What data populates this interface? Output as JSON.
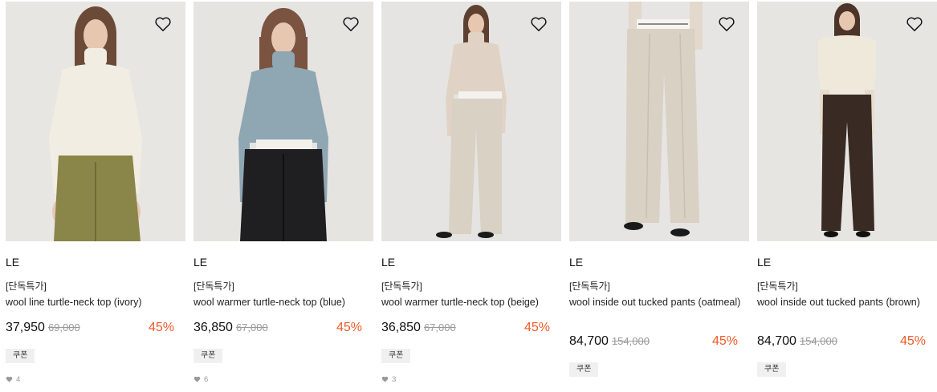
{
  "products": [
    {
      "brand": "LE",
      "promo": "[단독특가]",
      "name": "wool line turtle-neck top (ivory)",
      "price": "37,950",
      "original_price": "69,000",
      "discount": "45%",
      "coupon": "쿠폰",
      "likes": "4",
      "top_color": "#f1ede2",
      "bottom_color": "#8a8548",
      "bg_color": "#e8e6e3"
    },
    {
      "brand": "LE",
      "promo": "[단독특가]",
      "name": "wool warmer turtle-neck top (blue)",
      "price": "36,850",
      "original_price": "67,000",
      "discount": "45%",
      "coupon": "쿠폰",
      "likes": "6",
      "top_color": "#8fa6b3",
      "bottom_color": "#1f1f21",
      "bg_color": "#e6e4e1"
    },
    {
      "brand": "LE",
      "promo": "[단독특가]",
      "name": "wool warmer turtle-neck top (beige)",
      "price": "36,850",
      "original_price": "67,000",
      "discount": "45%",
      "coupon": "쿠폰",
      "likes": "3",
      "top_color": "#e0d3c6",
      "bottom_color": "#d8d1c4",
      "bg_color": "#e5e4e2"
    },
    {
      "brand": "LE",
      "promo": "[단독특가]",
      "name": "wool inside out tucked pants (oatmeal)",
      "price": "84,700",
      "original_price": "154,000",
      "discount": "45%",
      "coupon": "쿠폰",
      "likes": "",
      "top_color": "#e3d8cc",
      "bottom_color": "#d9d1c4",
      "bg_color": "#e6e5e3"
    },
    {
      "brand": "LE",
      "promo": "[단독특가]",
      "name": "wool inside out tucked pants (brown)",
      "price": "84,700",
      "original_price": "154,000",
      "discount": "45%",
      "coupon": "쿠폰",
      "likes": "",
      "top_color": "#efe9dc",
      "bottom_color": "#3a2a24",
      "bg_color": "#e7e5e2"
    }
  ],
  "accent_color": "#f05a28"
}
